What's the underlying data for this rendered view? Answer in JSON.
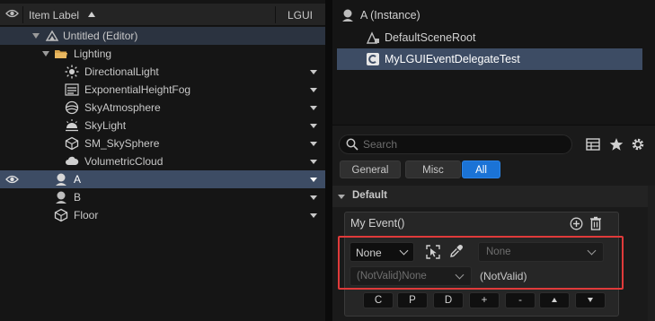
{
  "outliner": {
    "column_label": "Item Label",
    "column_lgui": "LGUI",
    "rows": [
      {
        "label": "Untitled (Editor)",
        "icon": "level-icon"
      },
      {
        "label": "Lighting",
        "icon": "folder-icon"
      },
      {
        "label": "DirectionalLight",
        "icon": "sun-icon"
      },
      {
        "label": "ExponentialHeightFog",
        "icon": "fog-icon"
      },
      {
        "label": "SkyAtmosphere",
        "icon": "atmosphere-icon"
      },
      {
        "label": "SkyLight",
        "icon": "skylight-icon"
      },
      {
        "label": "SM_SkySphere",
        "icon": "static-mesh-icon"
      },
      {
        "label": "VolumetricCloud",
        "icon": "cloud-icon"
      },
      {
        "label": "A",
        "icon": "actor-icon"
      },
      {
        "label": "B",
        "icon": "actor-icon"
      },
      {
        "label": "Floor",
        "icon": "static-mesh-icon"
      }
    ]
  },
  "components": {
    "items": [
      {
        "label": "A (Instance)",
        "icon": "actor-icon"
      },
      {
        "label": "DefaultSceneRoot",
        "icon": "scene-root-icon"
      },
      {
        "label": "MyLGUIEventDelegateTest",
        "icon": "cpp-class-icon"
      }
    ]
  },
  "search": {
    "placeholder": "Search"
  },
  "filters": {
    "general": "General",
    "misc": "Misc",
    "all": "All"
  },
  "category": {
    "label": "Default"
  },
  "event": {
    "title": "My Event()",
    "target_value": "None",
    "function_value": "None",
    "component_value": "(NotValid)None",
    "notvalid_text": "(NotValid)",
    "buttons": [
      "C",
      "P",
      "D",
      "+",
      "-"
    ]
  },
  "colors": {
    "selection": "#3d4c64",
    "accent": "#1b73d6",
    "highlight_border": "#e03a3a"
  }
}
